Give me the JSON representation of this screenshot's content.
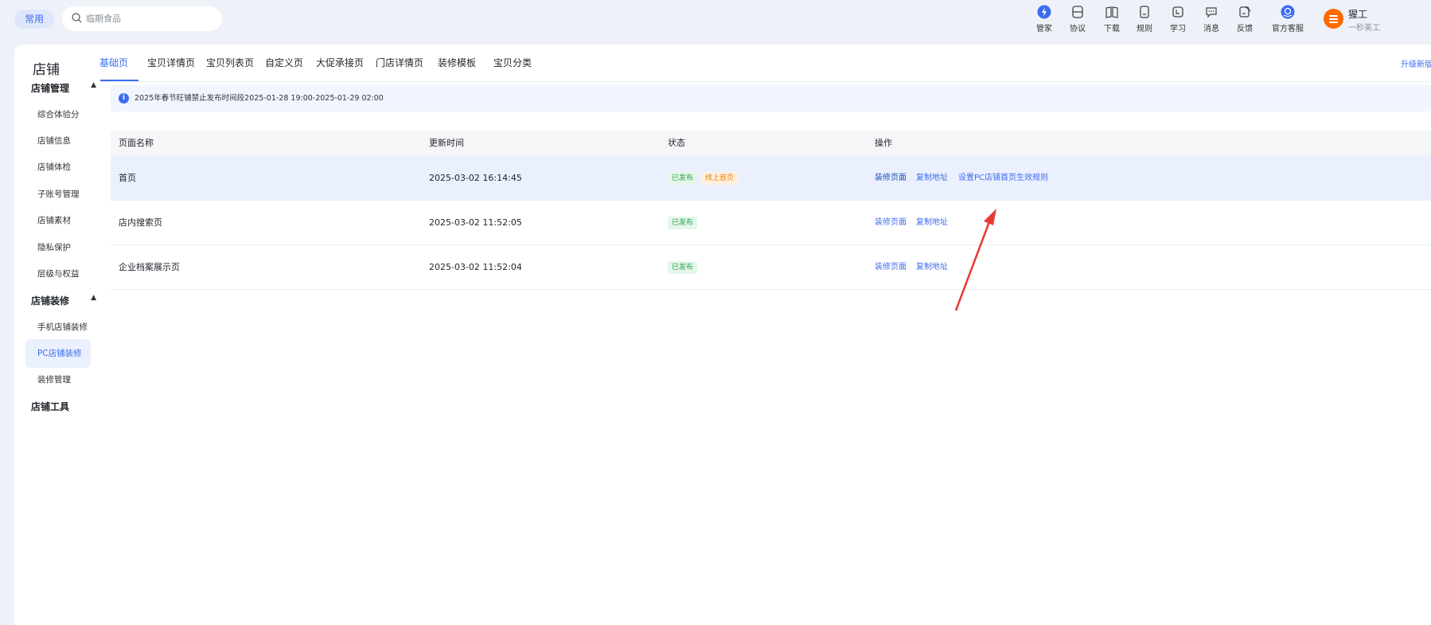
{
  "topbar": {
    "chip_label": "常用",
    "search_placeholder": "临期食品",
    "items": [
      {
        "label": "管家",
        "icon": "butler-icon"
      },
      {
        "label": "协议",
        "icon": "agreement-icon"
      },
      {
        "label": "下载",
        "icon": "download-icon"
      },
      {
        "label": "规则",
        "icon": "rules-icon"
      },
      {
        "label": "学习",
        "icon": "learn-icon"
      },
      {
        "label": "消息",
        "icon": "message-icon"
      },
      {
        "label": "反馈",
        "icon": "feedback-icon"
      },
      {
        "label": "官方客服",
        "icon": "service-icon"
      }
    ],
    "user": {
      "name": "猩工",
      "role": "一秒美工"
    }
  },
  "sidebar": {
    "title": "店铺",
    "groups": [
      {
        "label": "店铺管理",
        "items": [
          "综合体验分",
          "店铺信息",
          "店铺体检",
          "子账号管理",
          "店铺素材",
          "隐私保护",
          "层级与权益"
        ]
      },
      {
        "label": "店铺装修",
        "items": [
          "手机店铺装修",
          "PC店铺装修",
          "装修管理"
        ]
      },
      {
        "label": "店铺工具",
        "items": []
      }
    ],
    "active_item": "PC店铺装修"
  },
  "tabs": [
    "基础页",
    "宝贝详情页",
    "宝贝列表页",
    "自定义页",
    "大促承接页",
    "门店详情页",
    "装修模板",
    "宝贝分类"
  ],
  "upgrade_label": "升级新版",
  "notice": "2025年春节旺铺禁止发布时间段2025-01-28 19:00-2025-01-29 02:00",
  "table": {
    "headers": [
      "页面名称",
      "更新时间",
      "状态",
      "操作"
    ],
    "rows": [
      {
        "name": "首页",
        "time": "2025-03-02 16:14:45",
        "status": [
          "已发布",
          "线上首页"
        ],
        "ops": [
          "装修页面",
          "复制地址",
          "设置PC店铺首页生效规则"
        ]
      },
      {
        "name": "店内搜索页",
        "time": "2025-03-02 11:52:05",
        "status": [
          "已发布"
        ],
        "ops": [
          "装修页面",
          "复制地址"
        ]
      },
      {
        "name": "企业档案展示页",
        "time": "2025-03-02 11:52:04",
        "status": [
          "已发布"
        ],
        "ops": [
          "装修页面",
          "复制地址"
        ]
      }
    ]
  },
  "colors": {
    "accent": "#3d6cf0",
    "published": "#2ea44f",
    "online": "#f07d00",
    "annotation": "#e53935"
  }
}
